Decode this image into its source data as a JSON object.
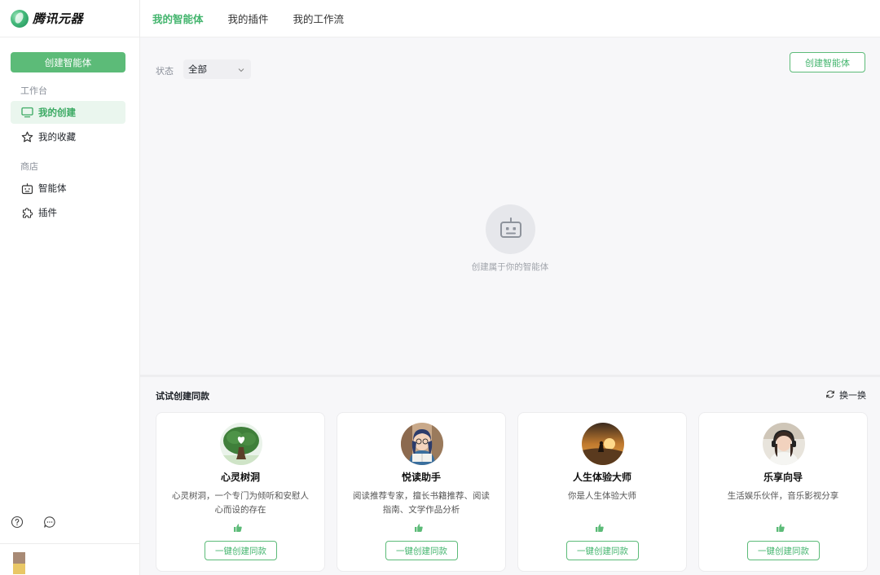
{
  "app": {
    "name": "腾讯元器"
  },
  "sidebar": {
    "create_label": "创建智能体",
    "sections": [
      {
        "title": "工作台",
        "items": [
          {
            "label": "我的创建",
            "icon": "monitor-icon",
            "active": true
          },
          {
            "label": "我的收藏",
            "icon": "star-icon",
            "active": false
          }
        ]
      },
      {
        "title": "商店",
        "items": [
          {
            "label": "智能体",
            "icon": "robot-icon",
            "active": false
          },
          {
            "label": "插件",
            "icon": "puzzle-icon",
            "active": false
          }
        ]
      }
    ],
    "bottom_icons": [
      "help-icon",
      "feedback-icon"
    ]
  },
  "tabs": [
    {
      "label": "我的智能体",
      "active": true
    },
    {
      "label": "我的插件",
      "active": false
    },
    {
      "label": "我的工作流",
      "active": false
    }
  ],
  "filter": {
    "label": "状态",
    "value": "全部"
  },
  "main": {
    "create_label": "创建智能体",
    "empty_text": "创建属于你的智能体"
  },
  "templates": {
    "title": "试试创建同款",
    "refresh_label": "换一换",
    "clone_label": "一键创建同款",
    "cards": [
      {
        "name": "心灵树洞",
        "desc": "心灵树洞，一个专门为倾听和安慰人心而设的存在"
      },
      {
        "name": "悦读助手",
        "desc": "阅读推荐专家，擅长书籍推荐、阅读指南、文学作品分析"
      },
      {
        "name": "人生体验大师",
        "desc": "你是人生体验大师"
      },
      {
        "name": "乐享向导",
        "desc": "生活娱乐伙伴，音乐影视分享"
      }
    ]
  },
  "colors": {
    "accent": "#44b56e",
    "accent_bg": "#eaf6ee",
    "button_fill": "#5cbb78"
  }
}
